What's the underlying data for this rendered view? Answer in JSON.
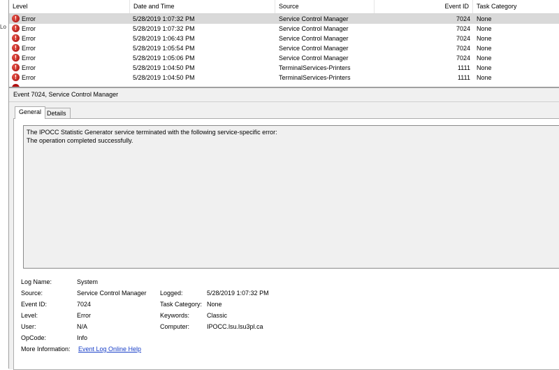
{
  "list": {
    "columns": [
      {
        "label": "Level"
      },
      {
        "label": "Date and Time"
      },
      {
        "label": "Source"
      },
      {
        "label": "Event ID"
      },
      {
        "label": "Task Category"
      }
    ],
    "rows": [
      {
        "level": "Error",
        "datetime": "5/28/2019 1:07:32 PM",
        "source": "Service Control Manager",
        "event_id": "7024",
        "category": "None"
      },
      {
        "level": "Error",
        "datetime": "5/28/2019 1:07:32 PM",
        "source": "Service Control Manager",
        "event_id": "7024",
        "category": "None"
      },
      {
        "level": "Error",
        "datetime": "5/28/2019 1:06:43 PM",
        "source": "Service Control Manager",
        "event_id": "7024",
        "category": "None"
      },
      {
        "level": "Error",
        "datetime": "5/28/2019 1:05:54 PM",
        "source": "Service Control Manager",
        "event_id": "7024",
        "category": "None"
      },
      {
        "level": "Error",
        "datetime": "5/28/2019 1:05:06 PM",
        "source": "Service Control Manager",
        "event_id": "7024",
        "category": "None"
      },
      {
        "level": "Error",
        "datetime": "5/28/2019 1:04:50 PM",
        "source": "TerminalServices-Printers",
        "event_id": "1111",
        "category": "None"
      },
      {
        "level": "Error",
        "datetime": "5/28/2019 1:04:50 PM",
        "source": "TerminalServices-Printers",
        "event_id": "1111",
        "category": "None"
      }
    ]
  },
  "left_edge": {
    "clipped_text": "Lo"
  },
  "details": {
    "title": "Event 7024, Service Control Manager",
    "tabs": [
      {
        "label": "General"
      },
      {
        "label": "Details"
      }
    ],
    "message_line1": "The IPOCC Statistic Generator service terminated with the following service-specific error:",
    "message_line2": "The operation completed successfully.",
    "labels": {
      "log_name": "Log Name:",
      "source": "Source:",
      "event_id": "Event ID:",
      "level": "Level:",
      "user": "User:",
      "opcode": "OpCode:",
      "more_info": "More Information:",
      "logged": "Logged:",
      "task_category": "Task Category:",
      "keywords": "Keywords:",
      "computer": "Computer:"
    },
    "values": {
      "log_name": "System",
      "source": "Service Control Manager",
      "event_id": "7024",
      "level": "Error",
      "user": "N/A",
      "opcode": "Info",
      "more_info_link": "Event Log Online Help",
      "logged": "5/28/2019 1:07:32 PM",
      "task_category": "None",
      "keywords": "Classic",
      "computer": "IPOCC.lsu.lsu3pl.ca"
    }
  },
  "colors": {
    "selected_row": "#d9d9d9",
    "error_icon": "#c0392b",
    "link": "#1a40c8",
    "pane_bg": "#f0f0f0"
  },
  "icons": {
    "error": "error-icon"
  }
}
